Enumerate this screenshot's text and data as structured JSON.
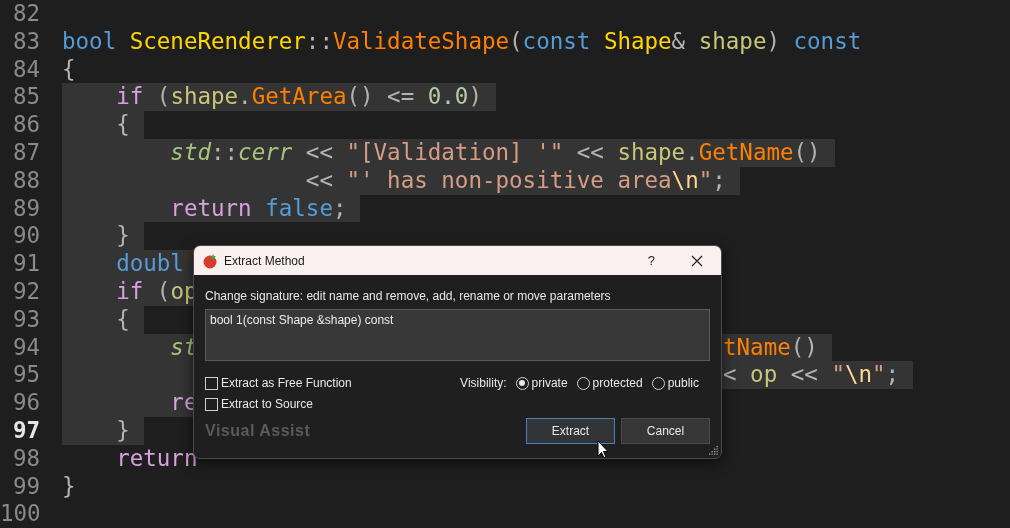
{
  "editor": {
    "lines": [
      {
        "number": "82",
        "current": false
      },
      {
        "number": "83",
        "current": false,
        "selected": false,
        "tokens": [
          {
            "kind": "keyword",
            "text": "bool "
          },
          {
            "kind": "type",
            "text": "SceneRenderer"
          },
          {
            "kind": "punct",
            "text": "::"
          },
          {
            "kind": "function",
            "text": "ValidateShape"
          },
          {
            "kind": "punct",
            "text": "("
          },
          {
            "kind": "keyword",
            "text": "const "
          },
          {
            "kind": "type",
            "text": "Shape"
          },
          {
            "kind": "punct",
            "text": "& "
          },
          {
            "kind": "param",
            "text": "shape"
          },
          {
            "kind": "punct",
            "text": ") "
          },
          {
            "kind": "keyword",
            "text": "const"
          }
        ]
      },
      {
        "number": "84",
        "current": false,
        "selected": false,
        "tokens": [
          {
            "kind": "punct",
            "text": "{"
          }
        ]
      },
      {
        "number": "85",
        "current": false,
        "selected": true,
        "tokens": [
          {
            "kind": "control",
            "text": "    if"
          },
          {
            "kind": "punct",
            "text": " ("
          },
          {
            "kind": "param",
            "text": "shape"
          },
          {
            "kind": "punct",
            "text": "."
          },
          {
            "kind": "function",
            "text": "GetArea"
          },
          {
            "kind": "punct",
            "text": "() <= "
          },
          {
            "kind": "number",
            "text": "0.0"
          },
          {
            "kind": "punct",
            "text": ")"
          }
        ]
      },
      {
        "number": "86",
        "current": false,
        "selected": true,
        "tokens": [
          {
            "kind": "punct",
            "text": "    {"
          }
        ]
      },
      {
        "number": "87",
        "current": false,
        "selected": true,
        "tokens": [
          {
            "kind": "namespace",
            "text": "        std"
          },
          {
            "kind": "punct",
            "text": "::"
          },
          {
            "kind": "namespace",
            "text": "cerr"
          },
          {
            "kind": "punct",
            "text": " << "
          },
          {
            "kind": "string",
            "text": "\"[Validation] '\""
          },
          {
            "kind": "punct",
            "text": " << "
          },
          {
            "kind": "param",
            "text": "shape"
          },
          {
            "kind": "punct",
            "text": "."
          },
          {
            "kind": "function",
            "text": "GetName"
          },
          {
            "kind": "punct",
            "text": "()"
          }
        ]
      },
      {
        "number": "88",
        "current": false,
        "selected": true,
        "tokens": [
          {
            "kind": "punct",
            "text": "                  << "
          },
          {
            "kind": "string",
            "text": "\"' has non-positive area"
          },
          {
            "kind": "escape",
            "text": "\\n"
          },
          {
            "kind": "string",
            "text": "\""
          },
          {
            "kind": "punct",
            "text": ";"
          }
        ]
      },
      {
        "number": "89",
        "current": false,
        "selected": true,
        "tokens": [
          {
            "kind": "control",
            "text": "        return "
          },
          {
            "kind": "keyword",
            "text": "false"
          },
          {
            "kind": "punct",
            "text": ";"
          }
        ]
      },
      {
        "number": "90",
        "current": false,
        "selected": true,
        "tokens": [
          {
            "kind": "punct",
            "text": "    }"
          }
        ]
      },
      {
        "number": "91",
        "current": false,
        "selected": true,
        "tokens": [
          {
            "kind": "keyword",
            "text": "    doubl"
          }
        ]
      },
      {
        "number": "92",
        "current": false,
        "selected": true,
        "tokens": [
          {
            "kind": "control",
            "text": "    if"
          },
          {
            "kind": "punct",
            "text": " ("
          },
          {
            "kind": "param",
            "text": "op"
          }
        ]
      },
      {
        "number": "93",
        "current": false,
        "selected": true,
        "tokens": [
          {
            "kind": "punct",
            "text": "    {"
          }
        ]
      },
      {
        "number": "94",
        "current": false,
        "selected": true,
        "tokens": [
          {
            "kind": "namespace",
            "text": "        st"
          }
        ],
        "right_tokens": [
          {
            "kind": "function",
            "text": "tName"
          },
          {
            "kind": "punct",
            "text": "()"
          }
        ]
      },
      {
        "number": "95",
        "current": false,
        "selected": true,
        "right_tokens": [
          {
            "kind": "punct",
            "text": "< "
          },
          {
            "kind": "param",
            "text": "op"
          },
          {
            "kind": "punct",
            "text": " << "
          },
          {
            "kind": "string",
            "text": "\""
          },
          {
            "kind": "escape",
            "text": "\\n"
          },
          {
            "kind": "string",
            "text": "\""
          },
          {
            "kind": "punct",
            "text": ";"
          }
        ]
      },
      {
        "number": "96",
        "current": false,
        "selected": true,
        "tokens": [
          {
            "kind": "control",
            "text": "        re"
          }
        ]
      },
      {
        "number": "97",
        "current": true,
        "selected": true,
        "tokens": [
          {
            "kind": "punct",
            "text": "    }"
          }
        ]
      },
      {
        "number": "98",
        "current": false,
        "selected": false,
        "tokens": [
          {
            "kind": "control",
            "text": "    return"
          }
        ]
      },
      {
        "number": "99",
        "current": false,
        "selected": false,
        "tokens": [
          {
            "kind": "punct",
            "text": "}"
          }
        ]
      },
      {
        "number": "100",
        "current": false
      }
    ]
  },
  "dialog": {
    "title": "Extract Method",
    "help": "?",
    "instruction": "Change signature: edit name and remove, add, rename or move parameters",
    "signature": "bool 1(const Shape &shape) const",
    "options": [
      {
        "label": "Extract as Free Function",
        "checked": false
      },
      {
        "label": "Extract to Source",
        "checked": false
      }
    ],
    "visibility": {
      "label": "Visibility:",
      "choices": [
        {
          "label": "private",
          "selected": true
        },
        {
          "label": "protected",
          "selected": false
        },
        {
          "label": "public",
          "selected": false
        }
      ]
    },
    "brand": "Visual Assist",
    "buttons": [
      {
        "label": "Extract",
        "focused": true
      },
      {
        "label": "Cancel",
        "focused": false
      }
    ]
  }
}
